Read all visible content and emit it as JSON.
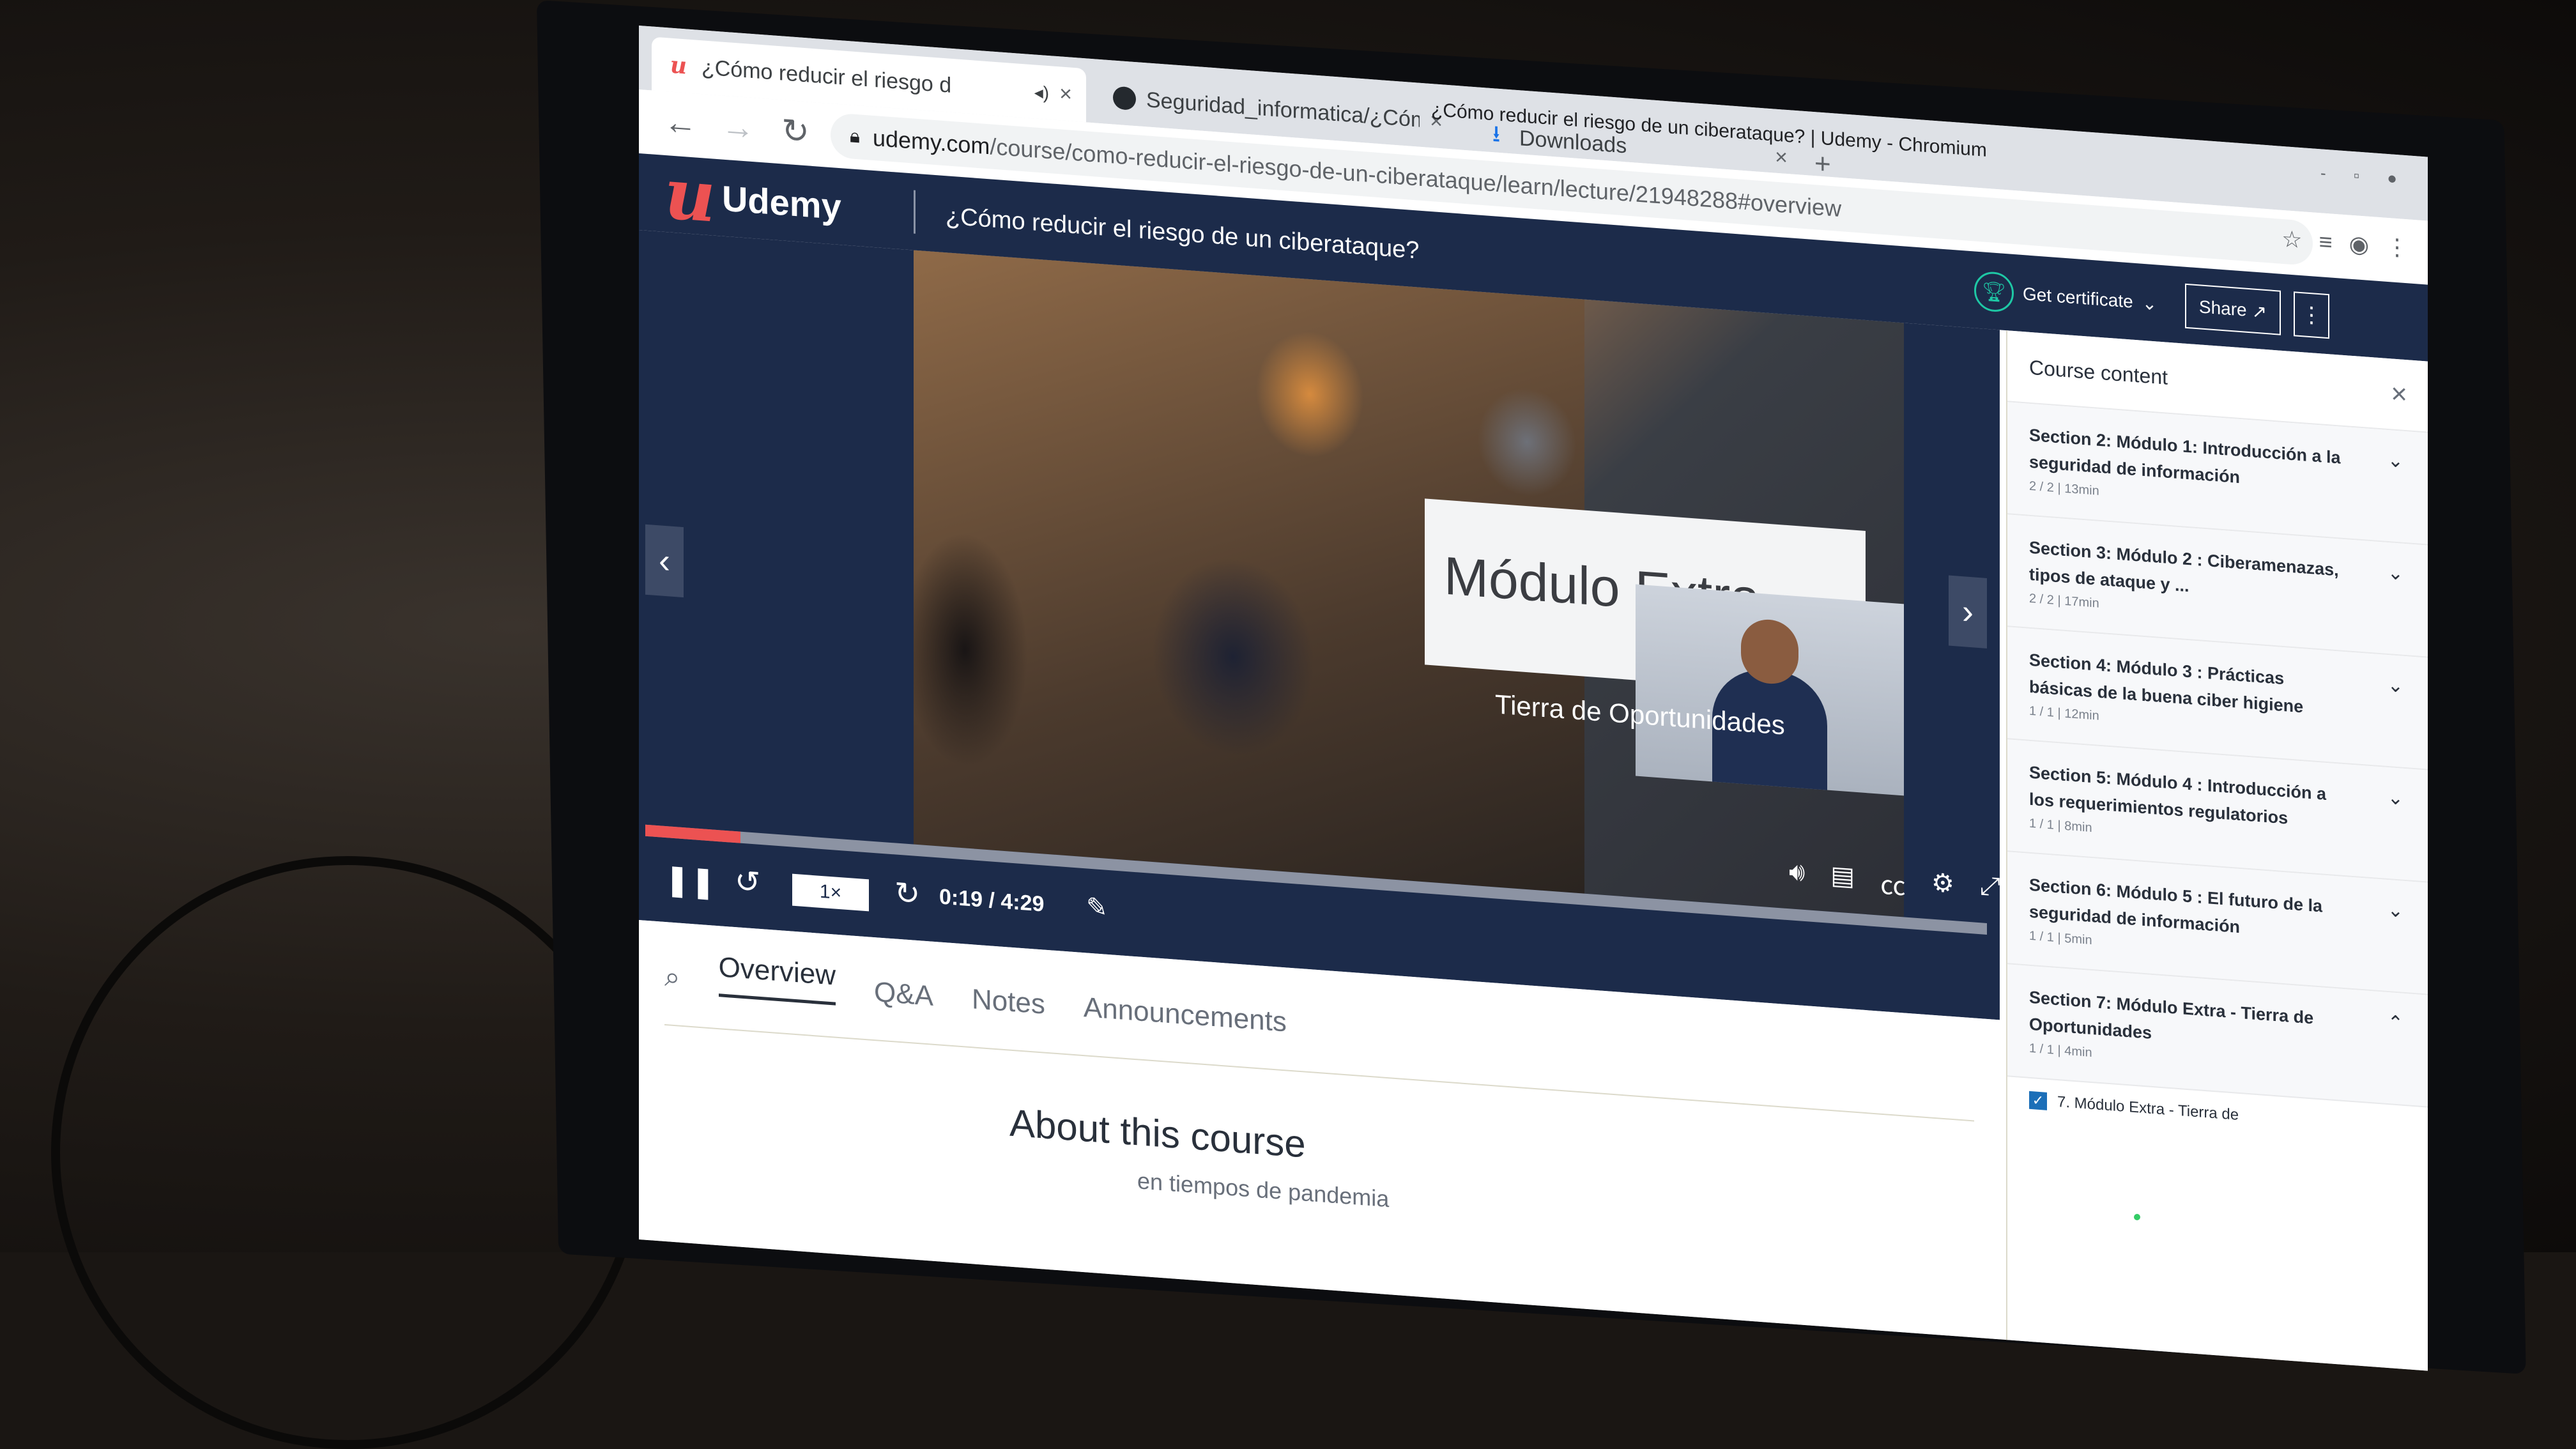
{
  "browser": {
    "window_title": "¿Cómo reducir el riesgo de un ciberataque? | Udemy - Chromium",
    "tabs": [
      {
        "label": "¿Cómo reducir el riesgo d",
        "favicon": "udemy-u-icon",
        "active": true
      },
      {
        "label": "Seguridad_informatica/¿Cóm",
        "favicon": "github-icon",
        "active": false
      },
      {
        "label": "Downloads",
        "favicon": "download-icon",
        "active": false
      }
    ],
    "new_tab": "+",
    "url_host": "udemy.com",
    "url_path": "/course/como-reducir-el-riesgo-de-un-ciberataque/learn/lecture/21948288#overview"
  },
  "header": {
    "logo_text": "Udemy",
    "course_title": "¿Cómo reducir el riesgo de un ciberataque?",
    "certificate_label": "Get certificate",
    "share_label": "Share"
  },
  "video": {
    "slide_title": "Módulo Extra",
    "slide_subtitle": "Tierra de Oportunidades",
    "speed": "1×",
    "time": "0:19 / 4:29",
    "progress": 0.071
  },
  "sidebar": {
    "title": "Course content",
    "close": "×",
    "sections": [
      {
        "title": "Section 2: Módulo 1: Introducción a la seguridad de información",
        "meta": "2 / 2 | 13min"
      },
      {
        "title": "Section 3: Módulo 2 : Ciberamenazas, tipos de ataque y ...",
        "meta": "2 / 2 | 17min"
      },
      {
        "title": "Section 4: Módulo 3 : Prácticas básicas de la buena ciber higiene",
        "meta": "1 / 1 | 12min"
      },
      {
        "title": "Section 5: Módulo 4 : Introducción a los requerimientos regulatorios",
        "meta": "1 / 1 | 8min"
      },
      {
        "title": "Section 6: Módulo 5 : El futuro de la seguridad de información",
        "meta": "1 / 1 | 5min"
      },
      {
        "title": "Section 7: Módulo Extra - Tierra de Oportunidades",
        "meta": "1 / 1 | 4min"
      }
    ],
    "current_lecture": "7. Módulo Extra - Tierra de"
  },
  "content_tabs": [
    "Overview",
    "Q&A",
    "Notes",
    "Announcements"
  ],
  "about": {
    "heading": "About this course",
    "subtitle": "en tiempos de pandemia"
  },
  "colors": {
    "udemy_navy": "#1c2b4a",
    "udemy_red": "#ec5252",
    "cert_teal": "#1ec8a5"
  }
}
